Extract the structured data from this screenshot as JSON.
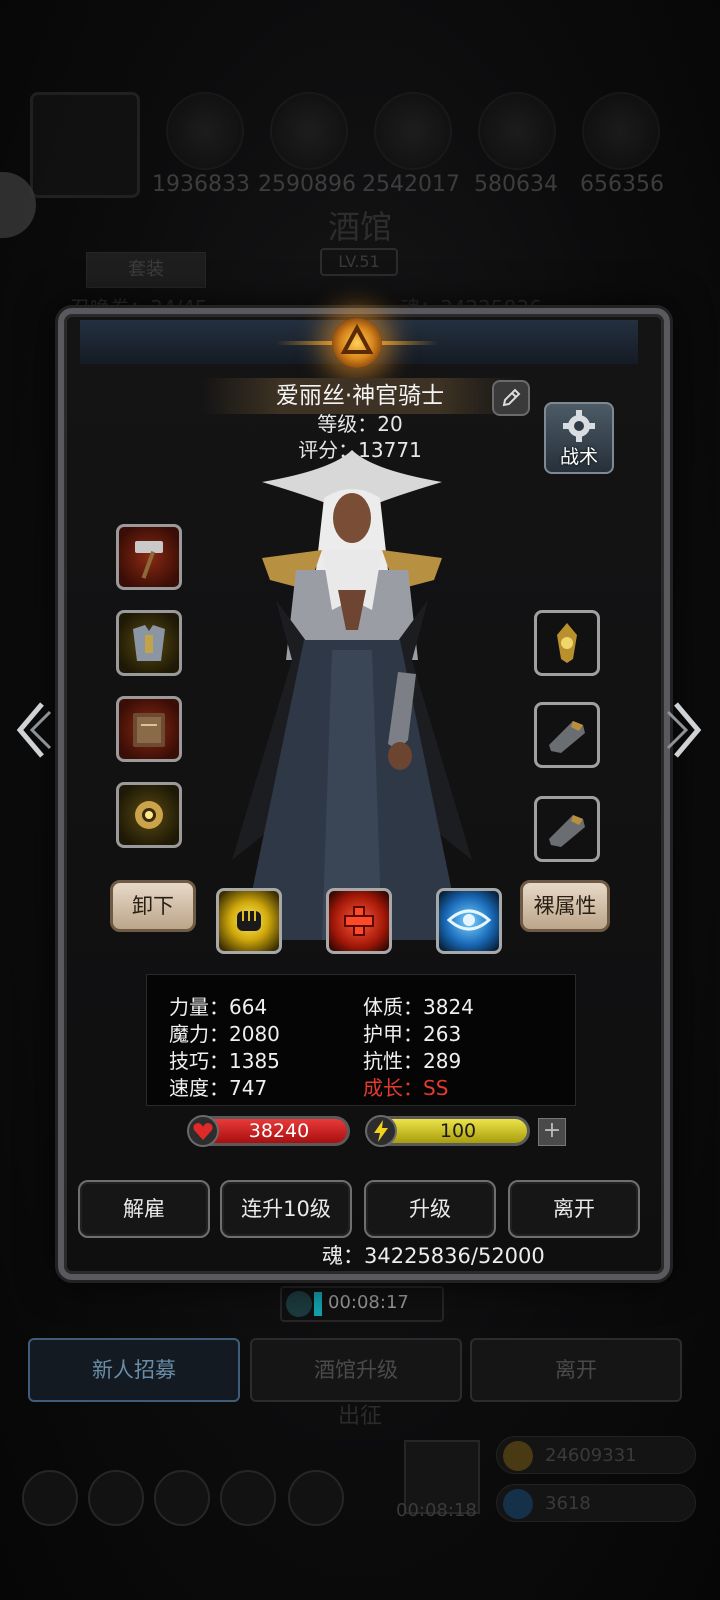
{
  "background": {
    "resources": [
      "1936833",
      "2590896",
      "2542017",
      "580634",
      "656356"
    ],
    "title": "酒馆",
    "level": "LV.51",
    "tab_label": "套装",
    "row_left": "召唤卷：34/45",
    "row_right": "魂：34225836",
    "timer": "00:08:17",
    "tabs": [
      {
        "label": "新人招募",
        "active": true
      },
      {
        "label": "酒馆升级",
        "active": false
      },
      {
        "label": "离开",
        "active": false
      }
    ],
    "sortie": "出征",
    "chest_timer": "00:08:18",
    "gold": "24609331",
    "gems": "3618"
  },
  "hero": {
    "name": "爱丽丝·神官骑士",
    "level_line": "等级：20",
    "score_line": "评分：13771",
    "tactics_label": "战术",
    "left_slots": [
      {
        "icon": "hammer-icon",
        "frame": "red"
      },
      {
        "icon": "armor-icon",
        "frame": "gold"
      },
      {
        "icon": "tome-icon",
        "frame": "red"
      },
      {
        "icon": "amulet-icon",
        "frame": "gold"
      }
    ],
    "right_slots": [
      {
        "icon": "gold-ornament-icon"
      },
      {
        "icon": "gauntlet-icon"
      },
      {
        "icon": "gauntlet-icon"
      }
    ],
    "unequip_label": "卸下",
    "base_attr_label": "裸属性",
    "skills": [
      {
        "icon": "fist-icon",
        "color": "#f2d21a"
      },
      {
        "icon": "cross-icon",
        "color": "#e0301c"
      },
      {
        "icon": "eye-icon",
        "color": "#2a8fe0"
      }
    ],
    "stats": {
      "str": "力量：664",
      "con": "体质：3824",
      "mag": "魔力：2080",
      "arm": "护甲：263",
      "dex": "技巧：1385",
      "res": "抗性：289",
      "spd": "速度：747",
      "growth": "成长：SS"
    },
    "hp": "38240",
    "energy": "100",
    "plus": "+",
    "buttons": [
      "解雇",
      "连升10级",
      "升级",
      "离开"
    ],
    "soul_line": "魂：34225836/52000"
  },
  "colors": {
    "accent_gold": "#d9861c",
    "hp_red": "#c41e1e",
    "energy_yellow": "#d6cc22",
    "growth_red": "#e23b2e"
  }
}
